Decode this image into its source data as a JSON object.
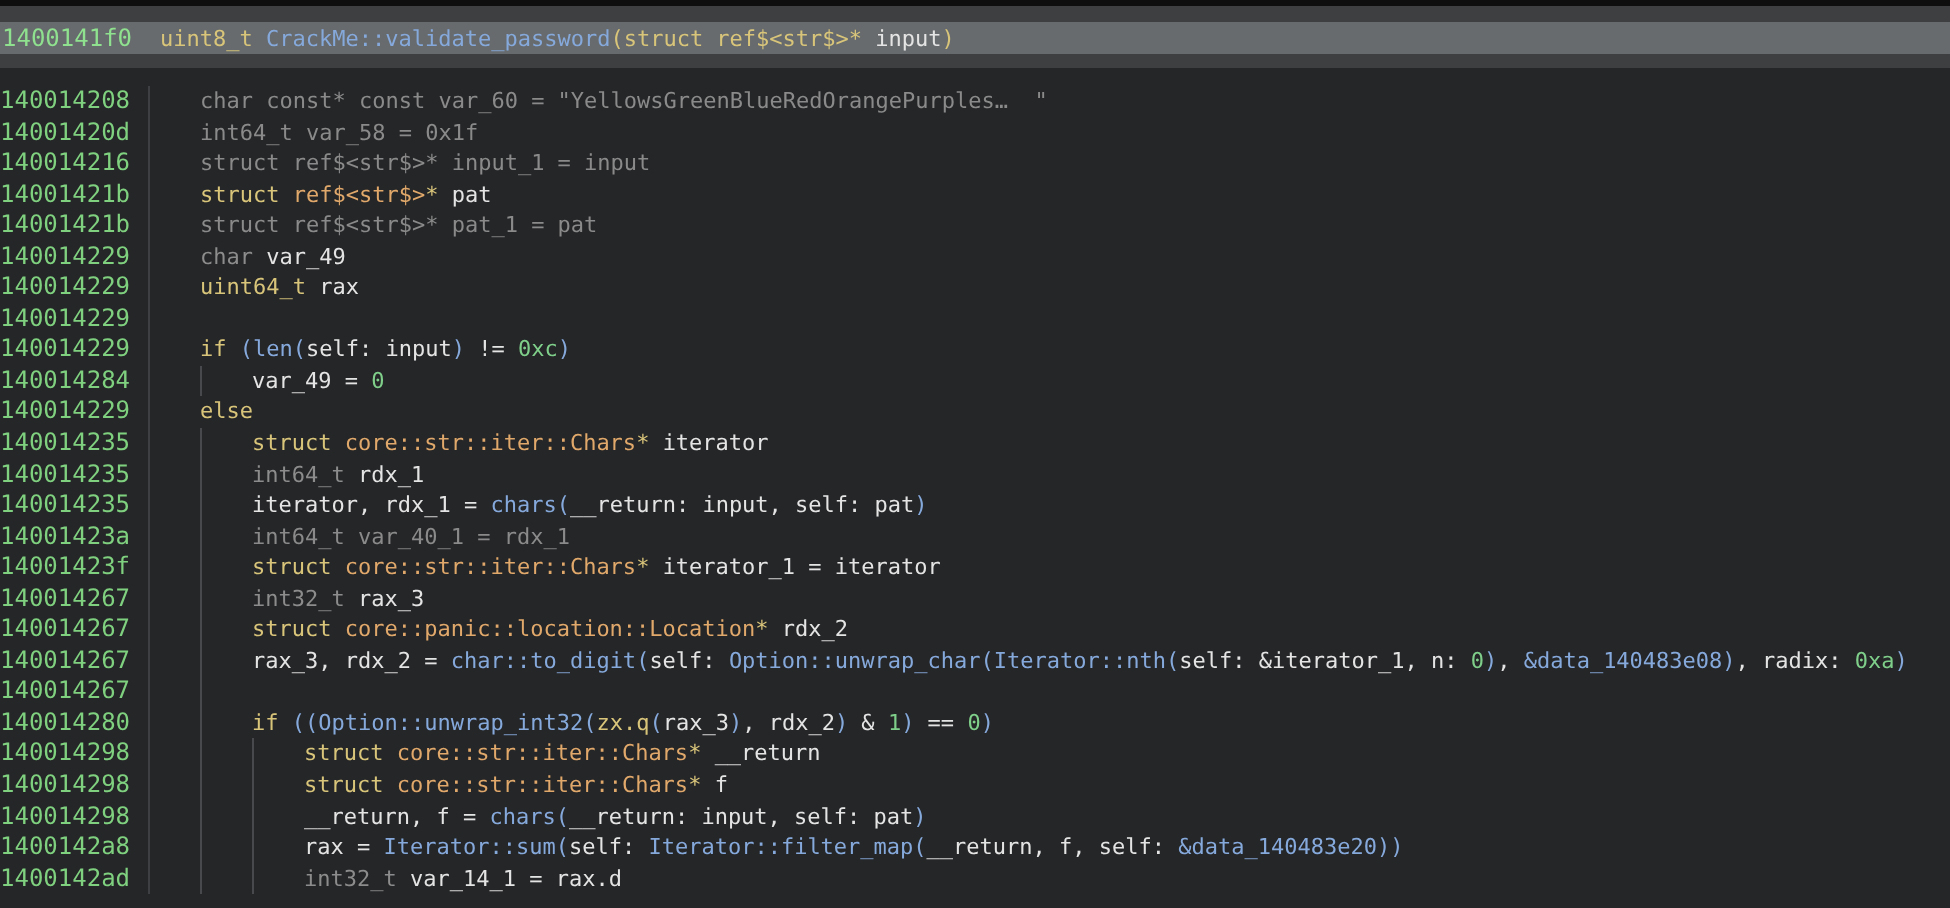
{
  "header": {
    "address": "1400141f0",
    "tokens": [
      {
        "kind": "type",
        "text": "uint8_t "
      },
      {
        "kind": "fn",
        "text": "CrackMe::validate_password"
      },
      {
        "kind": "type",
        "text": "(struct ref$<str$>* "
      },
      {
        "kind": "id",
        "text": "input"
      },
      {
        "kind": "type",
        "text": ")"
      }
    ]
  },
  "lines": [
    {
      "address": "140014208",
      "dim": true,
      "text": "char const* const var_60 = \"YellowsGreenBlueRedOrangePurples…  \""
    },
    {
      "address": "14001420d",
      "dim": true,
      "text": "int64_t var_58 = 0x1f"
    },
    {
      "address": "140014216",
      "dim": true,
      "text": "struct ref$<str$>* input_1 = input"
    },
    {
      "address": "14001421b",
      "dim": false,
      "tokens": [
        {
          "kind": "type",
          "text": "struct "
        },
        {
          "kind": "tname",
          "text": "ref$<str$>"
        },
        {
          "kind": "type",
          "text": "* "
        },
        {
          "kind": "id",
          "text": "pat"
        }
      ]
    },
    {
      "address": "14001421b",
      "dim": true,
      "text": "struct ref$<str$>* pat_1 = pat"
    },
    {
      "address": "140014229",
      "dim": false,
      "tokens": [
        {
          "kind": "muted",
          "text": "char "
        },
        {
          "kind": "id",
          "text": "var_49"
        }
      ]
    },
    {
      "address": "140014229",
      "dim": false,
      "tokens": [
        {
          "kind": "type",
          "text": "uint64_t "
        },
        {
          "kind": "id",
          "text": "rax"
        }
      ]
    },
    {
      "address": "140014229"
    },
    {
      "address": "140014229",
      "dim": false,
      "tokens": [
        {
          "kind": "kw",
          "text": "if "
        },
        {
          "kind": "punct",
          "text": "("
        },
        {
          "kind": "fn",
          "text": "len"
        },
        {
          "kind": "punct",
          "text": "("
        },
        {
          "kind": "id",
          "text": "self: input"
        },
        {
          "kind": "punct",
          "text": ")"
        },
        {
          "kind": "id",
          "text": " != "
        },
        {
          "kind": "num",
          "text": "0xc"
        },
        {
          "kind": "punct",
          "text": ")"
        }
      ],
      "children": [
        {
          "address": "140014284",
          "dim": false,
          "tokens": [
            {
              "kind": "id",
              "text": "var_49 = "
            },
            {
              "kind": "num",
              "text": "0"
            }
          ]
        }
      ]
    },
    {
      "address": "140014229",
      "dim": false,
      "tokens": [
        {
          "kind": "kw",
          "text": "else"
        }
      ],
      "children": [
        {
          "address": "140014235",
          "dim": false,
          "tokens": [
            {
              "kind": "type",
              "text": "struct "
            },
            {
              "kind": "tname",
              "text": "core::str::iter::Chars"
            },
            {
              "kind": "type",
              "text": "* "
            },
            {
              "kind": "id",
              "text": "iterator"
            }
          ]
        },
        {
          "address": "140014235",
          "dim": false,
          "tokens": [
            {
              "kind": "muted",
              "text": "int64_t "
            },
            {
              "kind": "id",
              "text": "rdx_1"
            }
          ]
        },
        {
          "address": "140014235",
          "dim": false,
          "tokens": [
            {
              "kind": "id",
              "text": "iterator, rdx_1 = "
            },
            {
              "kind": "fn",
              "text": "chars"
            },
            {
              "kind": "punct",
              "text": "("
            },
            {
              "kind": "id",
              "text": "__return: input, self: pat"
            },
            {
              "kind": "punct",
              "text": ")"
            }
          ]
        },
        {
          "address": "14001423a",
          "dim": true,
          "text": "int64_t var_40_1 = rdx_1"
        },
        {
          "address": "14001423f",
          "dim": false,
          "tokens": [
            {
              "kind": "type",
              "text": "struct "
            },
            {
              "kind": "tname",
              "text": "core::str::iter::Chars"
            },
            {
              "kind": "type",
              "text": "* "
            },
            {
              "kind": "id",
              "text": "iterator_1 = iterator"
            }
          ]
        },
        {
          "address": "140014267",
          "dim": false,
          "tokens": [
            {
              "kind": "muted",
              "text": "int32_t "
            },
            {
              "kind": "id",
              "text": "rax_3"
            }
          ]
        },
        {
          "address": "140014267",
          "dim": false,
          "tokens": [
            {
              "kind": "type",
              "text": "struct "
            },
            {
              "kind": "tname",
              "text": "core::panic::location::Location"
            },
            {
              "kind": "type",
              "text": "* "
            },
            {
              "kind": "id",
              "text": "rdx_2"
            }
          ]
        },
        {
          "address": "140014267",
          "dim": false,
          "tokens": [
            {
              "kind": "id",
              "text": "rax_3, rdx_2 = "
            },
            {
              "kind": "fn",
              "text": "char::to_digit"
            },
            {
              "kind": "punct",
              "text": "("
            },
            {
              "kind": "id",
              "text": "self: "
            },
            {
              "kind": "fn",
              "text": "Option::unwrap_char"
            },
            {
              "kind": "punct",
              "text": "("
            },
            {
              "kind": "fn",
              "text": "Iterator::nth"
            },
            {
              "kind": "punct",
              "text": "("
            },
            {
              "kind": "id",
              "text": "self: &iterator_1, n: "
            },
            {
              "kind": "num",
              "text": "0"
            },
            {
              "kind": "punct",
              "text": ")"
            },
            {
              "kind": "id",
              "text": ", "
            },
            {
              "kind": "data",
              "text": "&data_140483e08"
            },
            {
              "kind": "punct",
              "text": ")"
            },
            {
              "kind": "id",
              "text": ", radix: "
            },
            {
              "kind": "num",
              "text": "0xa"
            },
            {
              "kind": "punct",
              "text": ")"
            }
          ]
        },
        {
          "address": "140014267"
        },
        {
          "address": "140014280",
          "dim": false,
          "tokens": [
            {
              "kind": "kw",
              "text": "if "
            },
            {
              "kind": "punct",
              "text": "(("
            },
            {
              "kind": "fn",
              "text": "Option::unwrap_int32"
            },
            {
              "kind": "punct",
              "text": "("
            },
            {
              "kind": "type",
              "text": "zx.q"
            },
            {
              "kind": "punct",
              "text": "("
            },
            {
              "kind": "id",
              "text": "rax_3"
            },
            {
              "kind": "punct",
              "text": ")"
            },
            {
              "kind": "id",
              "text": ", rdx_2"
            },
            {
              "kind": "punct",
              "text": ")"
            },
            {
              "kind": "id",
              "text": " & "
            },
            {
              "kind": "num",
              "text": "1"
            },
            {
              "kind": "punct",
              "text": ")"
            },
            {
              "kind": "id",
              "text": " == "
            },
            {
              "kind": "num",
              "text": "0"
            },
            {
              "kind": "punct",
              "text": ")"
            }
          ],
          "children": [
            {
              "address": "140014298",
              "dim": false,
              "tokens": [
                {
                  "kind": "type",
                  "text": "struct "
                },
                {
                  "kind": "tname",
                  "text": "core::str::iter::Chars"
                },
                {
                  "kind": "type",
                  "text": "* "
                },
                {
                  "kind": "id",
                  "text": "__return"
                }
              ]
            },
            {
              "address": "140014298",
              "dim": false,
              "tokens": [
                {
                  "kind": "type",
                  "text": "struct "
                },
                {
                  "kind": "tname",
                  "text": "core::str::iter::Chars"
                },
                {
                  "kind": "type",
                  "text": "* "
                },
                {
                  "kind": "id",
                  "text": "f"
                }
              ]
            },
            {
              "address": "140014298",
              "dim": false,
              "tokens": [
                {
                  "kind": "id",
                  "text": "__return, f = "
                },
                {
                  "kind": "fn",
                  "text": "chars"
                },
                {
                  "kind": "punct",
                  "text": "("
                },
                {
                  "kind": "id",
                  "text": "__return: input, self: pat"
                },
                {
                  "kind": "punct",
                  "text": ")"
                }
              ]
            },
            {
              "address": "1400142a8",
              "dim": false,
              "tokens": [
                {
                  "kind": "id",
                  "text": "rax = "
                },
                {
                  "kind": "fn",
                  "text": "Iterator::sum"
                },
                {
                  "kind": "punct",
                  "text": "("
                },
                {
                  "kind": "id",
                  "text": "self: "
                },
                {
                  "kind": "fn",
                  "text": "Iterator::filter_map"
                },
                {
                  "kind": "punct",
                  "text": "("
                },
                {
                  "kind": "id",
                  "text": "__return, f, self: "
                },
                {
                  "kind": "data",
                  "text": "&data_140483e20"
                },
                {
                  "kind": "punct",
                  "text": "))"
                }
              ]
            },
            {
              "address": "1400142ad",
              "dim": false,
              "tokens": [
                {
                  "kind": "muted",
                  "text": "int32_t "
                },
                {
                  "kind": "id",
                  "text": "var_14_1 = rax.d"
                }
              ]
            }
          ]
        }
      ]
    }
  ]
}
